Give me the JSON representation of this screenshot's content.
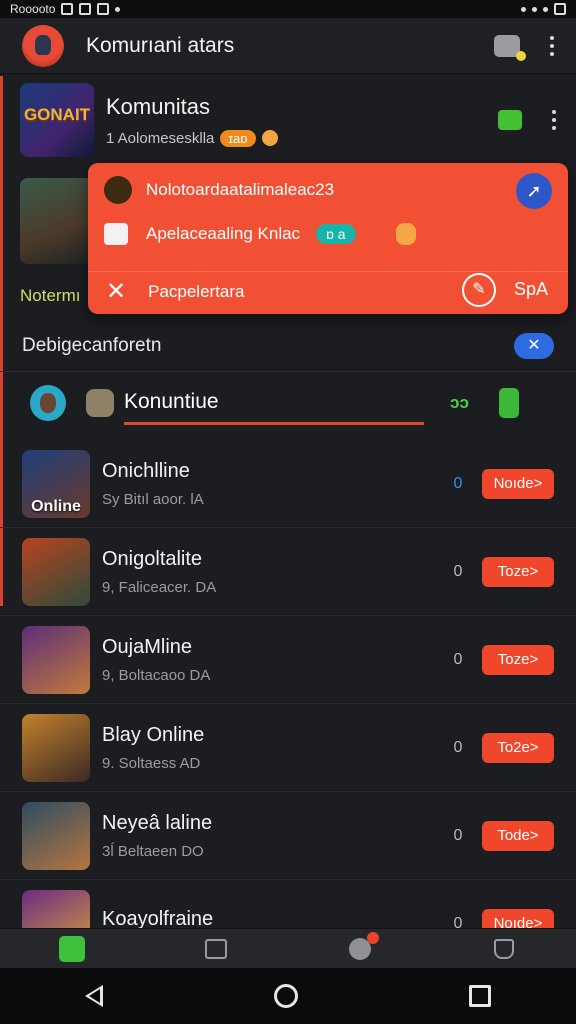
{
  "status_bar": {
    "left_text": "Rooooto"
  },
  "app_bar": {
    "title": "Komurıani atars"
  },
  "community": {
    "name": "Komunitas",
    "logo_text": "GONAIT",
    "subtitle": "1 Aolomesesklla",
    "badge": "ɪaɒ"
  },
  "notice_text": "Notermı",
  "popup": {
    "line1": "Nolotoardaatalimaleac23",
    "line2": "Apelaceaaling Knlac",
    "pill": "ɒ a",
    "line3": "Pacpelertara",
    "action_label": "SpA"
  },
  "section": {
    "title": "Debigecanforetn"
  },
  "tab": {
    "label": "Konuntiue",
    "green_text": "ɔɔ"
  },
  "games": [
    {
      "title": "Onichlline",
      "subtitle": "Sy Bitıl aoor. lA",
      "count": "0",
      "button": "Noıde>",
      "caption": "Online",
      "colors": [
        "#1f3f7a",
        "#6a3a2c"
      ],
      "count_blue": true
    },
    {
      "title": "Onigoltalite",
      "subtitle": "9, Faliceacer. DA",
      "count": "0",
      "button": "Toze>",
      "caption": "",
      "colors": [
        "#b8441f",
        "#2e4a3a"
      ],
      "count_blue": false
    },
    {
      "title": "OujaMline",
      "subtitle": "9, Boltacaoo DA",
      "count": "0",
      "button": "Toze>",
      "caption": "",
      "colors": [
        "#5b2f78",
        "#c27a3c"
      ],
      "count_blue": false
    },
    {
      "title": "Blay Online",
      "subtitle": "9. Soltaess AD",
      "count": "0",
      "button": "To2e>",
      "caption": "",
      "colors": [
        "#c4812e",
        "#3a2a22"
      ],
      "count_blue": false
    },
    {
      "title": "Neyeâ laline",
      "subtitle": "3ĺ Beltaeen DO",
      "count": "0",
      "button": "Tode>",
      "caption": "",
      "colors": [
        "#2d4c63",
        "#b6763f"
      ],
      "count_blue": false
    },
    {
      "title": "Koayolfraine",
      "subtitle": "",
      "count": "0",
      "button": "Noıde>",
      "caption": "",
      "colors": [
        "#6c2b82",
        "#d6a23a"
      ],
      "count_blue": false
    }
  ]
}
